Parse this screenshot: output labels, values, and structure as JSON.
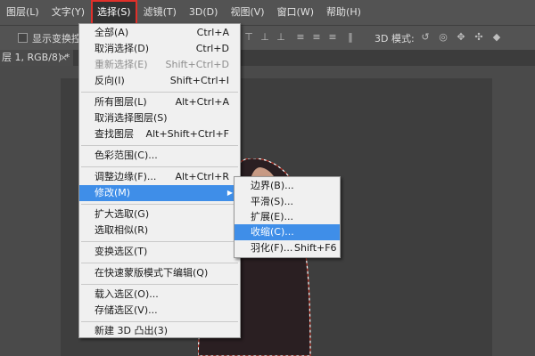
{
  "menubar": {
    "items": [
      "图层(L)",
      "文字(Y)",
      "选择(S)",
      "滤镜(T)",
      "3D(D)",
      "视图(V)",
      "窗口(W)",
      "帮助(H)"
    ]
  },
  "options": {
    "show_transform_label": "显示变换控件",
    "mode_3d_label": "3D 模式:"
  },
  "document_tab": {
    "title": "层 1, RGB/8) *",
    "close": "×"
  },
  "select_menu": {
    "items": [
      {
        "label": "全部(A)",
        "shortcut": "Ctrl+A"
      },
      {
        "label": "取消选择(D)",
        "shortcut": "Ctrl+D"
      },
      {
        "label": "重新选择(E)",
        "shortcut": "Shift+Ctrl+D"
      },
      {
        "label": "反向(I)",
        "shortcut": "Shift+Ctrl+I"
      },
      {
        "label": "所有图层(L)",
        "shortcut": "Alt+Ctrl+A"
      },
      {
        "label": "取消选择图层(S)",
        "shortcut": ""
      },
      {
        "label": "查找图层",
        "shortcut": "Alt+Shift+Ctrl+F"
      },
      {
        "label": "色彩范围(C)...",
        "shortcut": ""
      },
      {
        "label": "调整边缘(F)...",
        "shortcut": "Alt+Ctrl+R"
      },
      {
        "label": "修改(M)",
        "shortcut": ""
      },
      {
        "label": "扩大选取(G)",
        "shortcut": ""
      },
      {
        "label": "选取相似(R)",
        "shortcut": ""
      },
      {
        "label": "变换选区(T)",
        "shortcut": ""
      },
      {
        "label": "在快速蒙版模式下编辑(Q)",
        "shortcut": ""
      },
      {
        "label": "载入选区(O)...",
        "shortcut": ""
      },
      {
        "label": "存储选区(V)...",
        "shortcut": ""
      },
      {
        "label": "新建 3D 凸出(3)",
        "shortcut": ""
      }
    ]
  },
  "modify_submenu": {
    "items": [
      {
        "label": "边界(B)...",
        "shortcut": ""
      },
      {
        "label": "平滑(S)...",
        "shortcut": ""
      },
      {
        "label": "扩展(E)...",
        "shortcut": ""
      },
      {
        "label": "收缩(C)...",
        "shortcut": ""
      },
      {
        "label": "羽化(F)...",
        "shortcut": "Shift+F6"
      }
    ]
  },
  "colors": {
    "menu_highlight": "#3f8ee8",
    "active_menu_outline": "#e0302a",
    "selection_marquee": "#ffffff"
  }
}
